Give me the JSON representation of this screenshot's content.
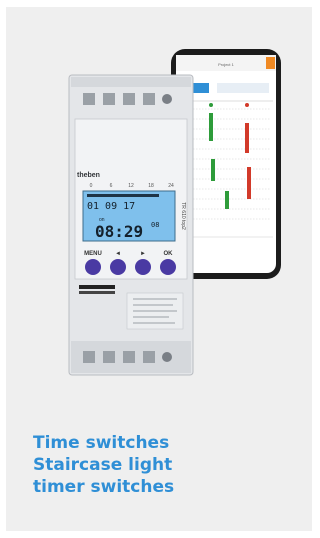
{
  "card": {
    "caption_lines": [
      "Time switches",
      "Staircase light",
      "timer switches"
    ]
  },
  "device": {
    "brand": "theben",
    "model": "TR 610 top2",
    "lcd_date": "01 09  17",
    "lcd_time": "08:29",
    "lcd_seconds": "08",
    "lcd_on": "on",
    "hour_scale": [
      "0",
      "6",
      "12",
      "18",
      "24"
    ],
    "buttons": [
      "MENU",
      "◄",
      "►",
      "OK"
    ]
  },
  "phone": {
    "title": "Project 1"
  },
  "colors": {
    "caption": "#2f8fd6",
    "lcd": "#7fc0ec",
    "button": "#4a3aa3",
    "on_bar": "#2e9c3a",
    "off_bar": "#d23a2a"
  }
}
